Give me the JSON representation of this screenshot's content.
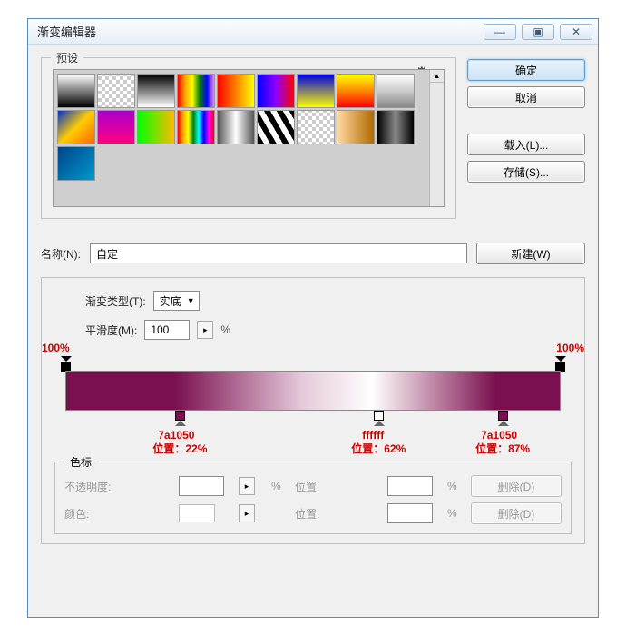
{
  "window": {
    "title": "渐变编辑器"
  },
  "buttons": {
    "ok": "确定",
    "cancel": "取消",
    "load": "载入(L)...",
    "save": "存储(S)...",
    "new": "新建(W)",
    "delete": "删除(D)"
  },
  "labels": {
    "presets_legend": "预设",
    "name": "名称(N):",
    "gradient_type": "渐变类型(T):",
    "smoothness": "平滑度(M):",
    "stops_legend": "色标",
    "opacity": "不透明度:",
    "position": "位置:",
    "color": "颜色:",
    "pct": "%"
  },
  "fields": {
    "name_value": "自定",
    "type_selected": "实底",
    "smoothness_value": "100"
  },
  "opacity_stops": [
    {
      "pos": 0,
      "label": "100%"
    },
    {
      "pos": 100,
      "label": "100%"
    }
  ],
  "color_stops": [
    {
      "pos": 22,
      "hex": "7a1050",
      "pos_label": "位置：22%"
    },
    {
      "pos": 62,
      "hex": "ffffff",
      "pos_label": "位置：62%"
    },
    {
      "pos": 87,
      "hex": "7a1050",
      "pos_label": "位置：87%"
    }
  ],
  "chart_data": {
    "type": "table",
    "title": "渐变色标",
    "columns": [
      "stop",
      "hex",
      "position_pct",
      "opacity_pct"
    ],
    "rows": [
      [
        "opacity-left",
        null,
        0,
        100
      ],
      [
        "opacity-right",
        null,
        100,
        100
      ],
      [
        "color-1",
        "7a1050",
        22,
        null
      ],
      [
        "color-2",
        "ffffff",
        62,
        null
      ],
      [
        "color-3",
        "7a1050",
        87,
        null
      ]
    ]
  }
}
